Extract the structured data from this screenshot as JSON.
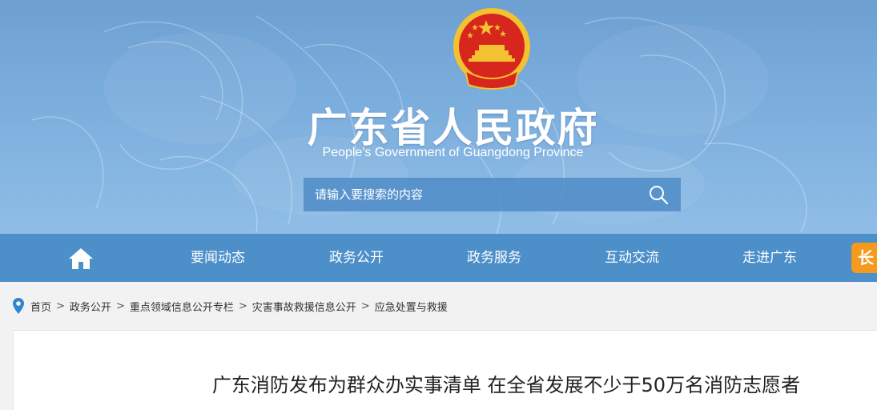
{
  "header": {
    "title": "广东省人民政府",
    "subtitle": "People's Government of Guangdong Province"
  },
  "search": {
    "placeholder": "请输入要搜索的内容"
  },
  "nav": {
    "items": [
      {
        "label": "要闻动态"
      },
      {
        "label": "政务公开"
      },
      {
        "label": "政务服务"
      },
      {
        "label": "互动交流"
      },
      {
        "label": "走进广东"
      }
    ],
    "extra_label": "长"
  },
  "breadcrumb": {
    "items": [
      {
        "label": "首页"
      },
      {
        "label": "政务公开"
      },
      {
        "label": "重点领域信息公开专栏"
      },
      {
        "label": "灾害事故救援信息公开"
      },
      {
        "label": "应急处置与救援"
      }
    ],
    "separator": ">"
  },
  "article": {
    "title": "广东消防发布为群众办实事清单 在全省发展不少于50万名消防志愿者"
  },
  "colors": {
    "nav_bg": "#4c8fc9",
    "banner_top": "#6d9fd2",
    "accent_orange": "#f39a1f",
    "emblem_red": "#d7261e",
    "emblem_gold": "#f2c230"
  }
}
